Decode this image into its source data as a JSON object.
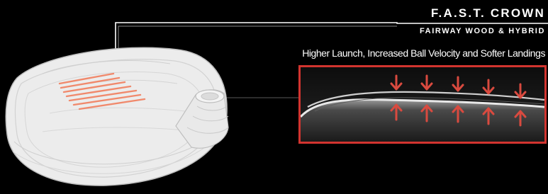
{
  "header": {
    "title": "F.A.S.T. CROWN",
    "subtitle": "FAIRWAY WOOD & HYBRID",
    "tagline": "Higher Launch, Increased Ball Velocity and Softer Landings"
  },
  "colors": {
    "background": "#000000",
    "accent": "#d2342f",
    "text": "#ffffff"
  },
  "illustration": {
    "club_head": "fairway-wood-head-outline",
    "crown_zone": "highlighted-crown-grooves",
    "detail": "crown-cross-section",
    "arrow_pairs": 5
  }
}
